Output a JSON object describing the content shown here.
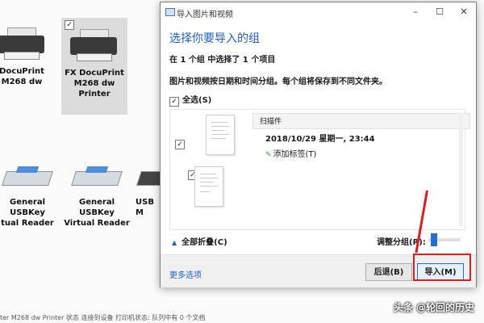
{
  "background": {
    "devices": [
      {
        "label": "DocuPrint\nM268 dw",
        "kind": "printer"
      },
      {
        "label": "FX DocuPrint\nM268 dw\nPrinter",
        "kind": "printer",
        "selected": true
      },
      {
        "label": "General\nUSBKey\ntual Reader",
        "kind": "usb"
      },
      {
        "label": "General\nUSBKey\nVirtual Reader",
        "kind": "usb"
      },
      {
        "label": "USB\nM",
        "kind": "keyboard"
      }
    ],
    "status_line": "ter M268 dw Printer  状态    连接到设备    打印机状态: 队列中有 0 个文档",
    "watermark": "头条 @轮回的历史"
  },
  "dialog": {
    "title": "导入图片和视频",
    "window_buttons": {
      "minimize": "–",
      "maximize": "☐",
      "close": "✕"
    },
    "heading": "选择你要导入的组",
    "summary": "在 1 个组 中选择了 1 个项目",
    "description": "图片和视频按日期和时间分组。每个组将保存到不同文件夹。",
    "select_all": "全选(S)",
    "group": {
      "name_placeholder": "扫描件",
      "datetime": "2018/10/29 星期一, 23:44",
      "add_tag": "添加标签(T)"
    },
    "collapse_all": "全部折叠(C)",
    "adjust_group": "调整分组(R):",
    "slider_level": 0.1,
    "more_options": "更多选项",
    "back_button": "后退(B)",
    "import_button": "导入(M)"
  },
  "colors": {
    "accent": "#1f5fbf",
    "highlight": "#e01b1b"
  }
}
